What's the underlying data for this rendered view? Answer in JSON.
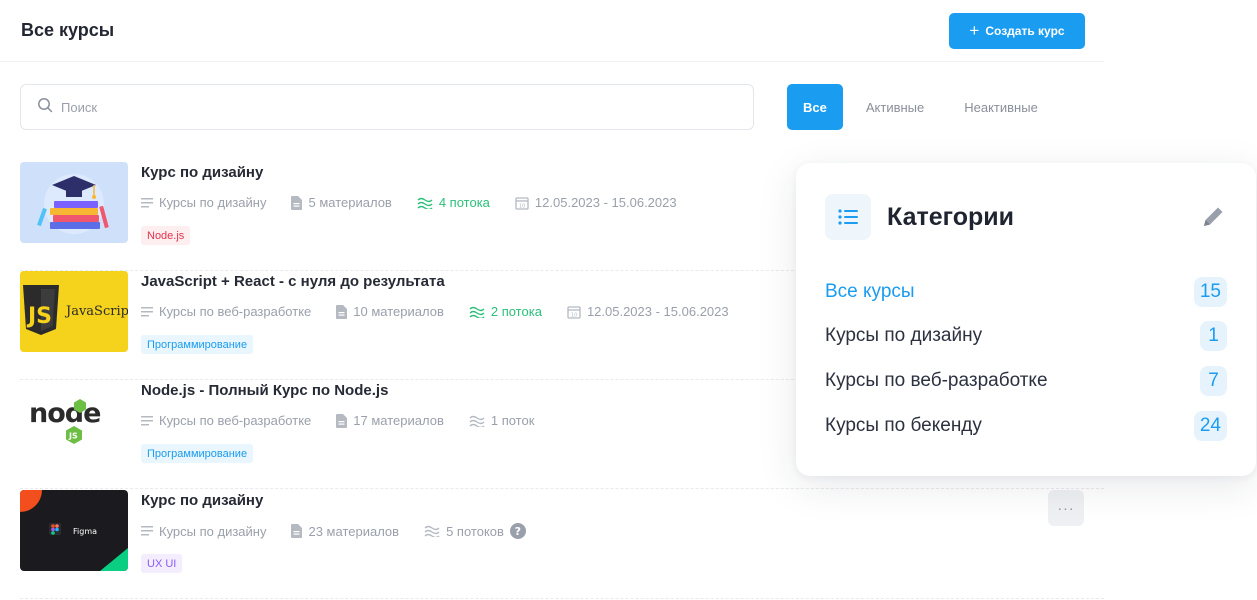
{
  "header": {
    "title": "Все курсы",
    "create_label": "Создать курс"
  },
  "search": {
    "placeholder": "Поиск"
  },
  "filters": {
    "all": "Все",
    "active": "Активные",
    "inactive": "Неактивные"
  },
  "courses": [
    {
      "title": "Курс по дизайну",
      "category": "Курсы по дизайну",
      "materials": "5 материалов",
      "streams": "4 потока",
      "dates": "12.05.2023 - 15.06.2023",
      "tag": "Node.js"
    },
    {
      "title": "JavaScript + React - с нуля до результата",
      "category": "Курсы по веб-разработке",
      "materials": "10 материалов",
      "streams": "2 потока",
      "dates": "12.05.2023 - 15.06.2023",
      "tag": "Программирование",
      "thumb_text": "JavaScript"
    },
    {
      "title": "Node.js - Полный Курс по Node.js",
      "category": "Курсы по веб-разработке",
      "materials": "17 материалов",
      "streams": "1 поток",
      "tag": "Программирование"
    },
    {
      "title": "Курс по дизайну",
      "category": "Курсы по дизайну",
      "materials": "23 материалов",
      "streams": "5 потоков",
      "tag": "UX UI",
      "thumb_text": "Figma"
    }
  ],
  "categories": {
    "title": "Категории",
    "items": [
      {
        "label": "Все курсы",
        "count": "15"
      },
      {
        "label": "Курсы по дизайну",
        "count": "1"
      },
      {
        "label": "Курсы по веб-разработке",
        "count": "7"
      },
      {
        "label": "Курсы по бекенду",
        "count": "24"
      }
    ]
  },
  "colors": {
    "accent": "#1a9cf0",
    "green": "#2bbf7a",
    "tag_red": "#e2354c",
    "tag_purple": "#8b5cf6"
  },
  "icons": [
    "plus-icon",
    "search-icon",
    "list-icon",
    "document-icon",
    "waves-icon",
    "calendar-icon",
    "help-icon",
    "more-icon",
    "pencil-icon"
  ]
}
